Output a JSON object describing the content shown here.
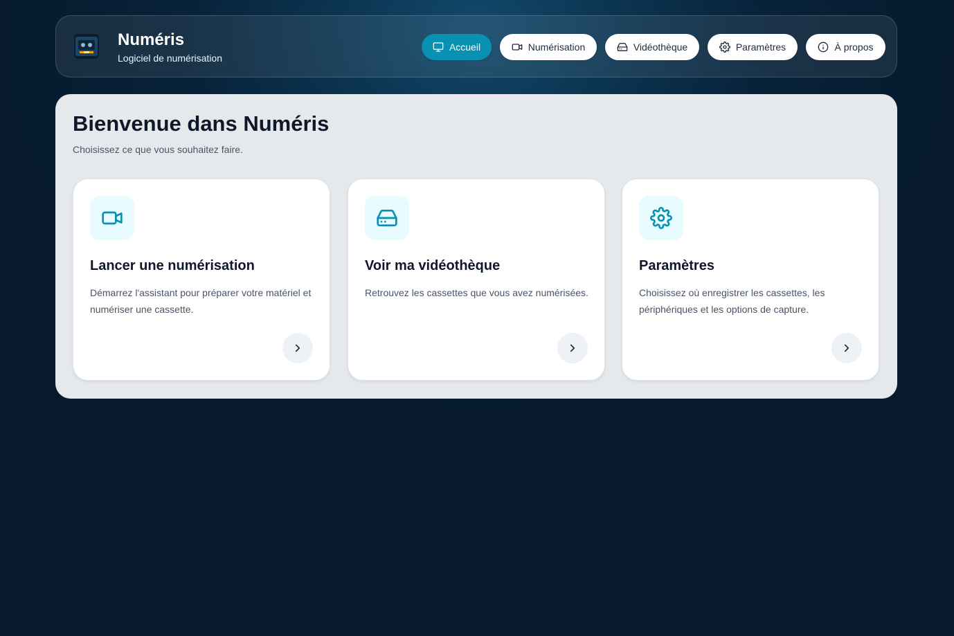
{
  "app": {
    "name": "Numéris",
    "subtitle": "Logiciel de numérisation"
  },
  "nav": {
    "items": [
      {
        "label": "Accueil",
        "icon": "monitor-icon",
        "active": true
      },
      {
        "label": "Numérisation",
        "icon": "video-camera-icon",
        "active": false
      },
      {
        "label": "Vidéothèque",
        "icon": "hard-drive-icon",
        "active": false
      },
      {
        "label": "Paramètres",
        "icon": "gear-icon",
        "active": false
      },
      {
        "label": "À propos",
        "icon": "info-icon",
        "active": false
      }
    ]
  },
  "main": {
    "title": "Bienvenue dans Numéris",
    "subtitle": "Choisissez ce que vous souhaitez faire.",
    "cards": [
      {
        "icon": "video-camera-icon",
        "title": "Lancer une numérisation",
        "description": "Démarrez l'assistant pour préparer votre matériel et numériser une cassette."
      },
      {
        "icon": "hard-drive-icon",
        "title": "Voir ma vidéothèque",
        "description": "Retrouvez les cassettes que vous avez numérisées."
      },
      {
        "icon": "gear-icon",
        "title": "Paramètres",
        "description": "Choisissez où enregistrer les cassettes, les périphériques et les options de capture."
      }
    ]
  },
  "colors": {
    "accent": "#0891b2",
    "icon_bg": "#e8fbff",
    "panel_bg": "#e6e9ec",
    "background": "#061a2c"
  }
}
